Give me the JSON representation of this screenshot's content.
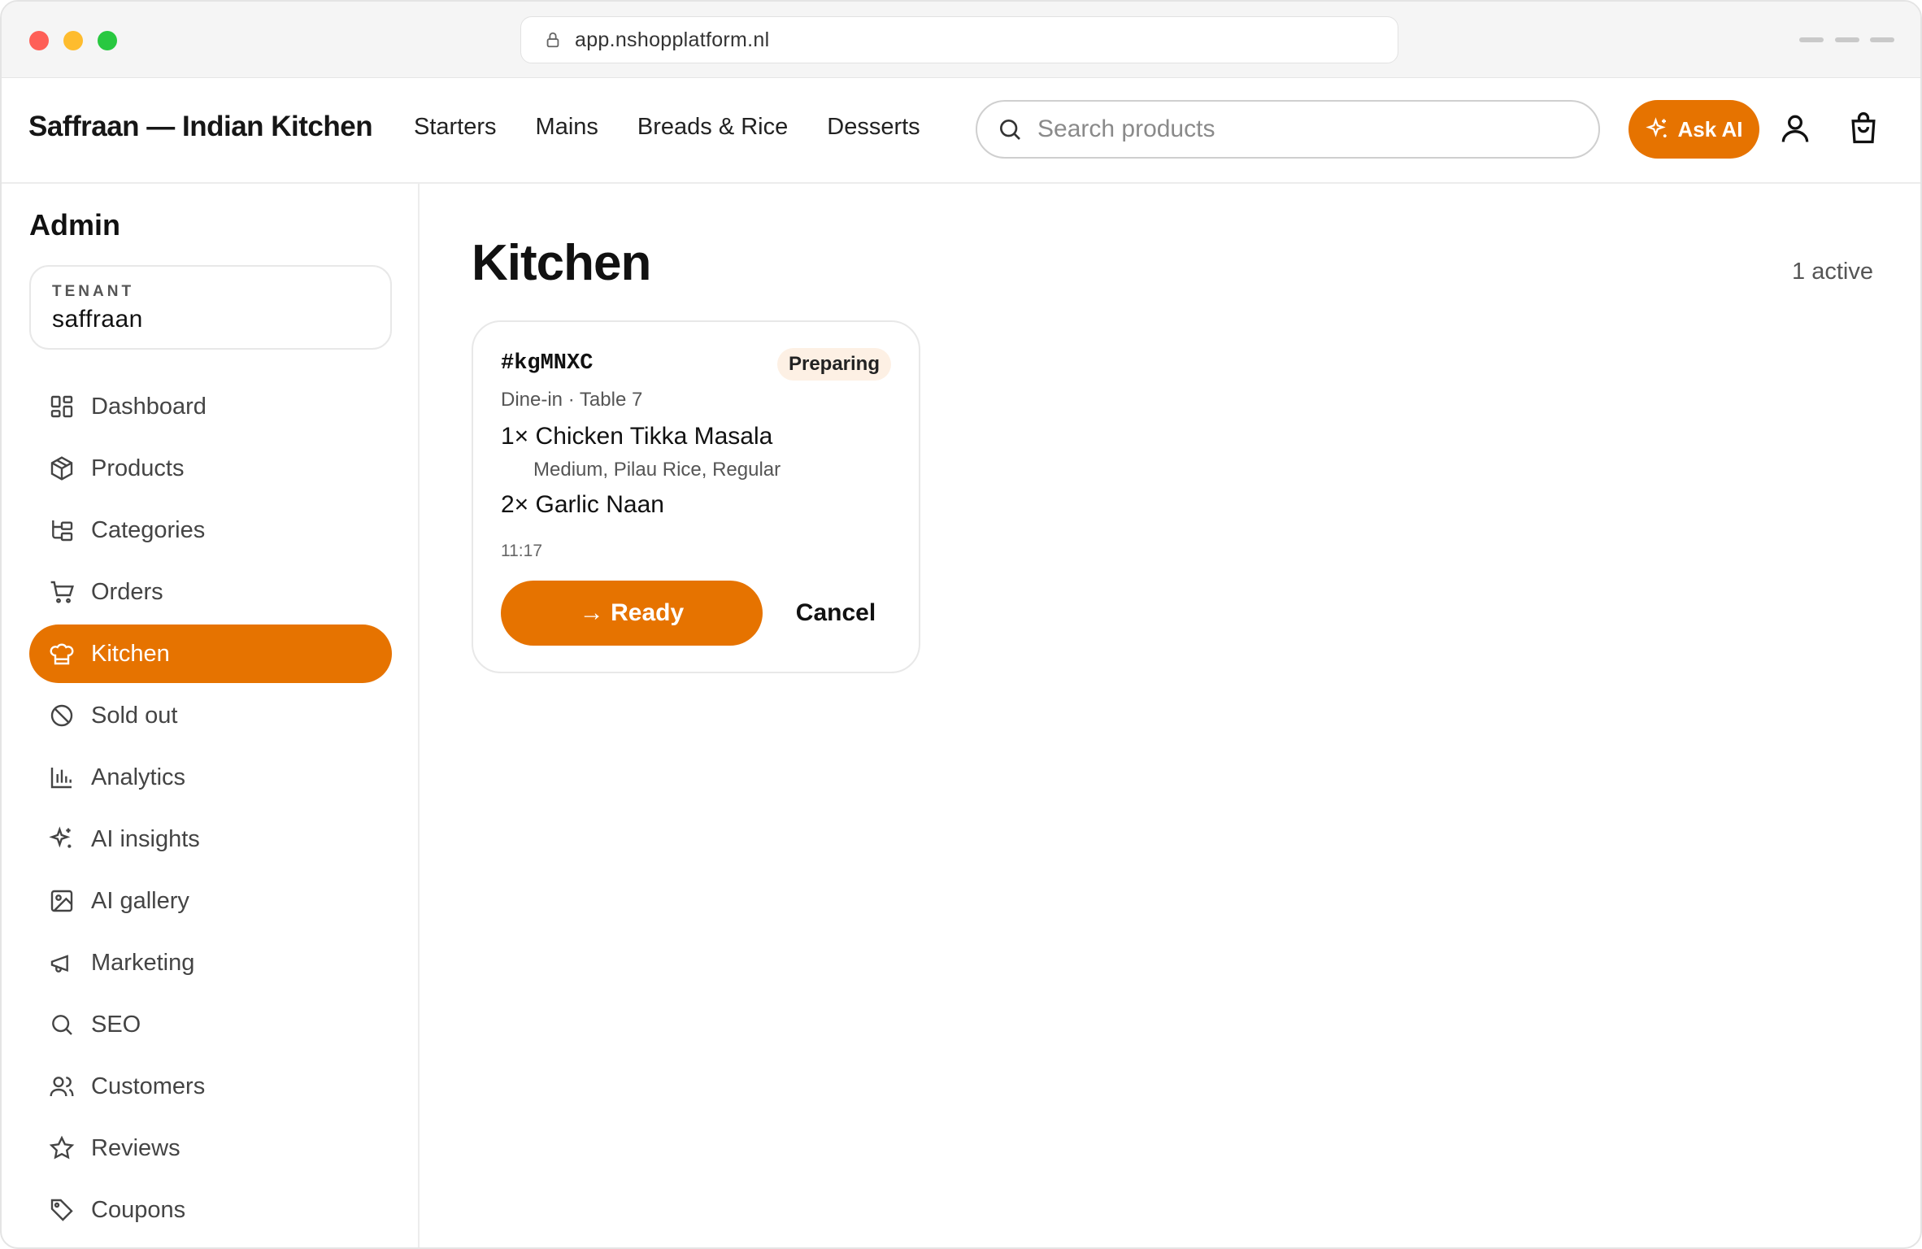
{
  "browser": {
    "url": "app.nshopplatform.nl"
  },
  "header": {
    "brand": "Saffraan — Indian Kitchen",
    "nav": [
      "Starters",
      "Mains",
      "Breads & Rice",
      "Desserts"
    ],
    "search_placeholder": "Search products",
    "ask_ai_label": "Ask AI",
    "accent_color": "#e67300"
  },
  "sidebar": {
    "title": "Admin",
    "tenant_label": "TENANT",
    "tenant_value": "saffraan",
    "items": [
      {
        "label": "Dashboard",
        "icon": "dashboard-icon"
      },
      {
        "label": "Products",
        "icon": "box-icon"
      },
      {
        "label": "Categories",
        "icon": "tree-icon"
      },
      {
        "label": "Orders",
        "icon": "cart-icon"
      },
      {
        "label": "Kitchen",
        "icon": "chef-hat-icon",
        "active": true
      },
      {
        "label": "Sold out",
        "icon": "ban-icon"
      },
      {
        "label": "Analytics",
        "icon": "bar-chart-icon"
      },
      {
        "label": "AI insights",
        "icon": "sparkle-icon"
      },
      {
        "label": "AI gallery",
        "icon": "image-icon"
      },
      {
        "label": "Marketing",
        "icon": "megaphone-icon"
      },
      {
        "label": "SEO",
        "icon": "search-icon"
      },
      {
        "label": "Customers",
        "icon": "users-icon"
      },
      {
        "label": "Reviews",
        "icon": "star-icon"
      },
      {
        "label": "Coupons",
        "icon": "tag-icon"
      }
    ]
  },
  "main": {
    "title": "Kitchen",
    "active_count": "1 active",
    "orders": [
      {
        "id": "#kgMNXC",
        "status": "Preparing",
        "meta": "Dine-in · Table 7",
        "lines": [
          {
            "text": "1× Chicken Tikka Masala",
            "modifiers": "Medium, Pilau Rice, Regular"
          },
          {
            "text": "2× Garlic Naan",
            "modifiers": ""
          }
        ],
        "time": "11:17",
        "ready_label": "→ Ready",
        "cancel_label": "Cancel"
      }
    ]
  }
}
